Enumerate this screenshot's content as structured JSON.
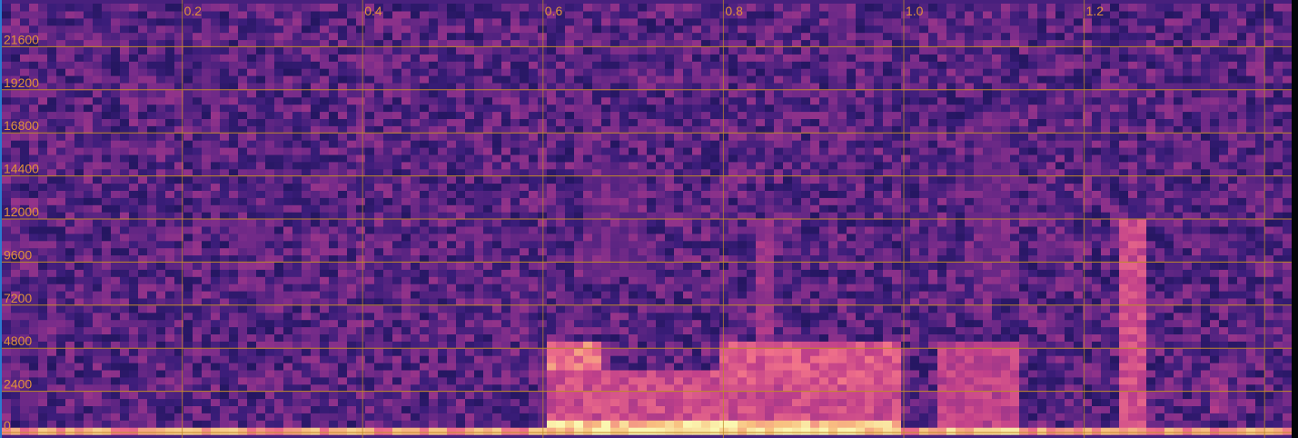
{
  "chart_data": {
    "type": "heatmap",
    "title": "",
    "xlabel": "",
    "ylabel": "",
    "x_ticks": [
      {
        "value": 0.2,
        "label": "0.2"
      },
      {
        "value": 0.4,
        "label": "0.4"
      },
      {
        "value": 0.6,
        "label": "0.6"
      },
      {
        "value": 0.8,
        "label": "0.8"
      },
      {
        "value": 1.0,
        "label": "1.0"
      },
      {
        "value": 1.2,
        "label": "1.2"
      }
    ],
    "y_ticks": [
      {
        "value": 0,
        "label": "0"
      },
      {
        "value": 2400,
        "label": "2400"
      },
      {
        "value": 4800,
        "label": "4800"
      },
      {
        "value": 7200,
        "label": "7200"
      },
      {
        "value": 9600,
        "label": "9600"
      },
      {
        "value": 12000,
        "label": "12000"
      },
      {
        "value": 14400,
        "label": "14400"
      },
      {
        "value": 16800,
        "label": "16800"
      },
      {
        "value": 19200,
        "label": "19200"
      },
      {
        "value": 21600,
        "label": "21600"
      }
    ],
    "xlim": [
      0,
      1.43
    ],
    "ylim": [
      0,
      24000
    ],
    "grid": true,
    "colormap": [
      "#10104a",
      "#3b1d7a",
      "#7a2c8a",
      "#c2418a",
      "#f0708a",
      "#f8c080",
      "#fbf6b0"
    ],
    "grid_color": "#c08a2a",
    "label_color": "#e0903a",
    "energy_regions": [
      {
        "t": [
          0.0,
          1.43
        ],
        "f": [
          0,
          200
        ],
        "level": 0.85
      },
      {
        "t": [
          0.6,
          1.0
        ],
        "f": [
          0,
          700
        ],
        "level": 1.0
      },
      {
        "t": [
          1.04,
          1.13
        ],
        "f": [
          0,
          500
        ],
        "level": 0.95
      },
      {
        "t": [
          0.6,
          1.0
        ],
        "f": [
          700,
          3600
        ],
        "level": 0.6
      },
      {
        "t": [
          0.6,
          0.66
        ],
        "f": [
          3600,
          5200
        ],
        "level": 0.75
      },
      {
        "t": [
          0.8,
          1.0
        ],
        "f": [
          3000,
          5200
        ],
        "level": 0.65
      },
      {
        "t": [
          1.04,
          1.13
        ],
        "f": [
          500,
          5000
        ],
        "level": 0.55
      },
      {
        "t": [
          1.24,
          1.27
        ],
        "f": [
          0,
          12000
        ],
        "level": 0.6
      },
      {
        "t": [
          1.34,
          1.36
        ],
        "f": [
          1200,
          3000
        ],
        "level": 0.45
      },
      {
        "t": [
          0.84,
          0.86
        ],
        "f": [
          0,
          12000
        ],
        "level": 0.45
      },
      {
        "t": [
          1.08,
          1.12
        ],
        "f": [
          8000,
          18000
        ],
        "level": 0.3
      },
      {
        "t": [
          0.92,
          0.94
        ],
        "f": [
          16000,
          24000
        ],
        "level": 0.3
      },
      {
        "t": [
          0.25,
          0.29
        ],
        "f": [
          10000,
          12000
        ],
        "level": 0.3
      },
      {
        "t": [
          0.64,
          0.72
        ],
        "f": [
          9000,
          15000
        ],
        "level": 0.3
      }
    ]
  }
}
